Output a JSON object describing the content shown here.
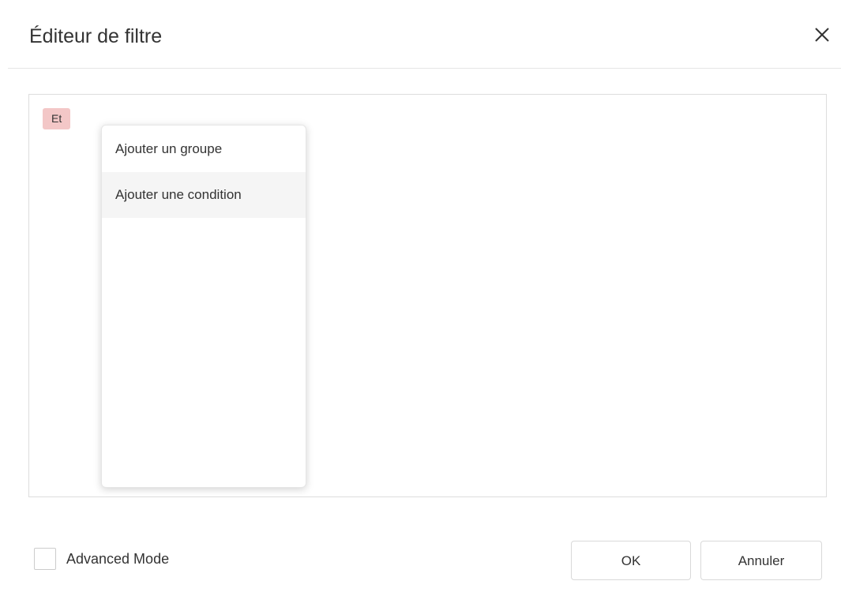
{
  "dialog": {
    "title": "Éditeur de filtre",
    "close_icon": "close-icon"
  },
  "filter": {
    "group_operator": "Et",
    "group_operator_color": "#f3c7c7"
  },
  "menu": {
    "items": [
      {
        "label": "Ajouter un groupe"
      },
      {
        "label": "Ajouter une condition"
      }
    ],
    "hovered_index": 1
  },
  "footer": {
    "advanced_mode_label": "Advanced Mode",
    "advanced_mode_checked": false,
    "ok_label": "OK",
    "cancel_label": "Annuler"
  }
}
